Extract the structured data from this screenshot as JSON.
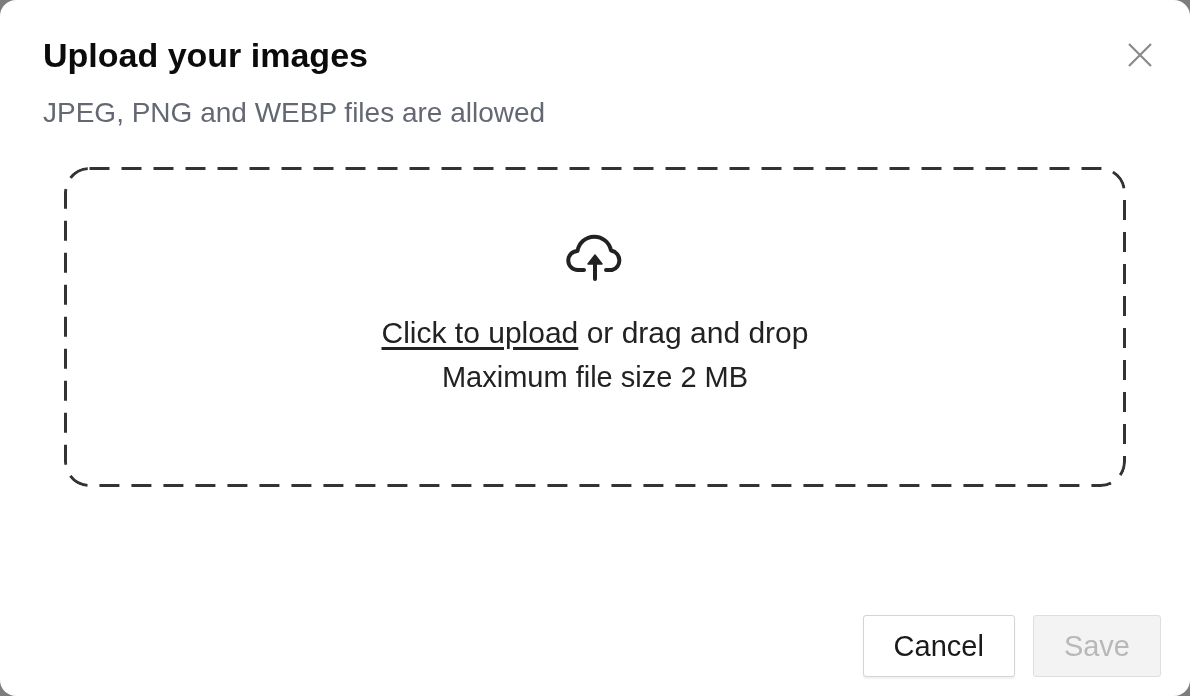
{
  "dialog": {
    "title": "Upload your images",
    "subtitle": "JPEG, PNG and WEBP files are allowed"
  },
  "dropzone": {
    "link": "Click to upload",
    "text": "or drag and drop",
    "hint": "Maximum file size 2 MB"
  },
  "buttons": [
    {
      "label": "Cancel",
      "disabled": false
    },
    {
      "label": "Save",
      "disabled": true
    }
  ]
}
